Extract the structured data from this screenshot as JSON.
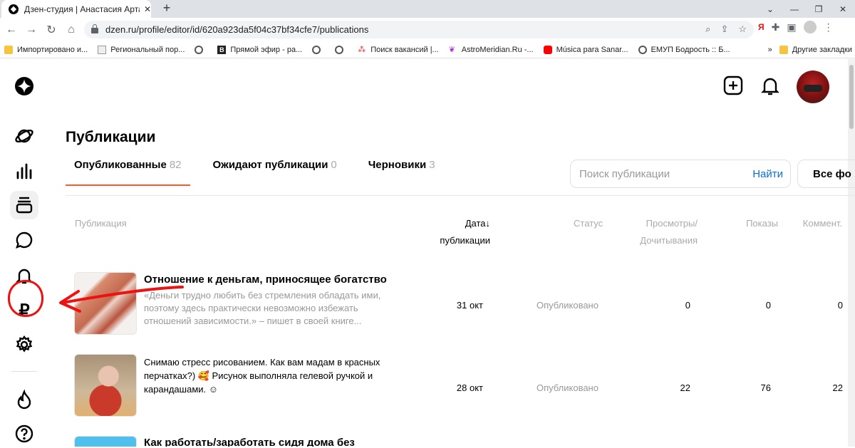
{
  "browser": {
    "tab_title": "Дзен-студия | Анастасия Артамо",
    "tab_close": "✕",
    "new_tab": "+",
    "url": "dzen.ru/profile/editor/id/620a923da5f04c37bf34cfe7/publications",
    "bookmarks": [
      {
        "label": "Импортировано и...",
        "icon": "folder"
      },
      {
        "label": "Региональный пор...",
        "icon": "page"
      },
      {
        "label": "",
        "icon": "globe"
      },
      {
        "label": "Прямой эфир - ра...",
        "icon": "b-logo"
      },
      {
        "label": "",
        "icon": "globe"
      },
      {
        "label": "",
        "icon": "globe"
      },
      {
        "label": "Поиск вакансий |...",
        "icon": "hh"
      },
      {
        "label": "AstroMeridian.Ru -...",
        "icon": "astro"
      },
      {
        "label": "Música para Sanar...",
        "icon": "youtube"
      },
      {
        "label": "ЕМУП Бодрость :: Б...",
        "icon": "globe"
      }
    ],
    "bookmarks_more": "»",
    "other_bookmarks": "Другие закладки",
    "ya_label": "Я"
  },
  "page": {
    "title": "Публикации",
    "tabs": [
      {
        "label": "Опубликованные",
        "count": "82"
      },
      {
        "label": "Ожидают публикации",
        "count": "0"
      },
      {
        "label": "Черновики",
        "count": "3"
      }
    ],
    "search": {
      "placeholder": "Поиск публикации",
      "button": "Найти"
    },
    "filter_label": "Все фо",
    "columns": {
      "publication": "Публикация",
      "date_line1": "Дата",
      "date_sort": "↓",
      "date_line2": "публикации",
      "status": "Статус",
      "views_line1": "Просмотры/",
      "views_line2": "Дочитывания",
      "shows": "Показы",
      "comments": "Коммент."
    },
    "rows": [
      {
        "title": "Отношение к деньгам, приносящее богатство",
        "description": "«Деньги трудно любить без стремления обладать ими, поэтому здесь практически невозможно избежать отношений зависимости.» – пишет в своей книге...",
        "date": "31 окт",
        "status": "Опубликовано",
        "views": "0",
        "shows": "0",
        "comments": "0"
      },
      {
        "title": "",
        "description": "Снимаю стресс рисованием. Как вам мадам в красных перчатках?) 🥰 Рисунок выполняла гелевой ручкой и карандашами. ☺",
        "date": "28 окт",
        "status": "Опубликовано",
        "views": "22",
        "shows": "76",
        "comments": "22"
      },
      {
        "title": "Как работать/заработать сидя дома без",
        "description": "",
        "date": "",
        "status": "",
        "views": "",
        "shows": "",
        "comments": ""
      }
    ]
  },
  "colors": {
    "accent": "#ff5a2c",
    "link": "#0a6fd6",
    "annotation": "#ee1111"
  }
}
